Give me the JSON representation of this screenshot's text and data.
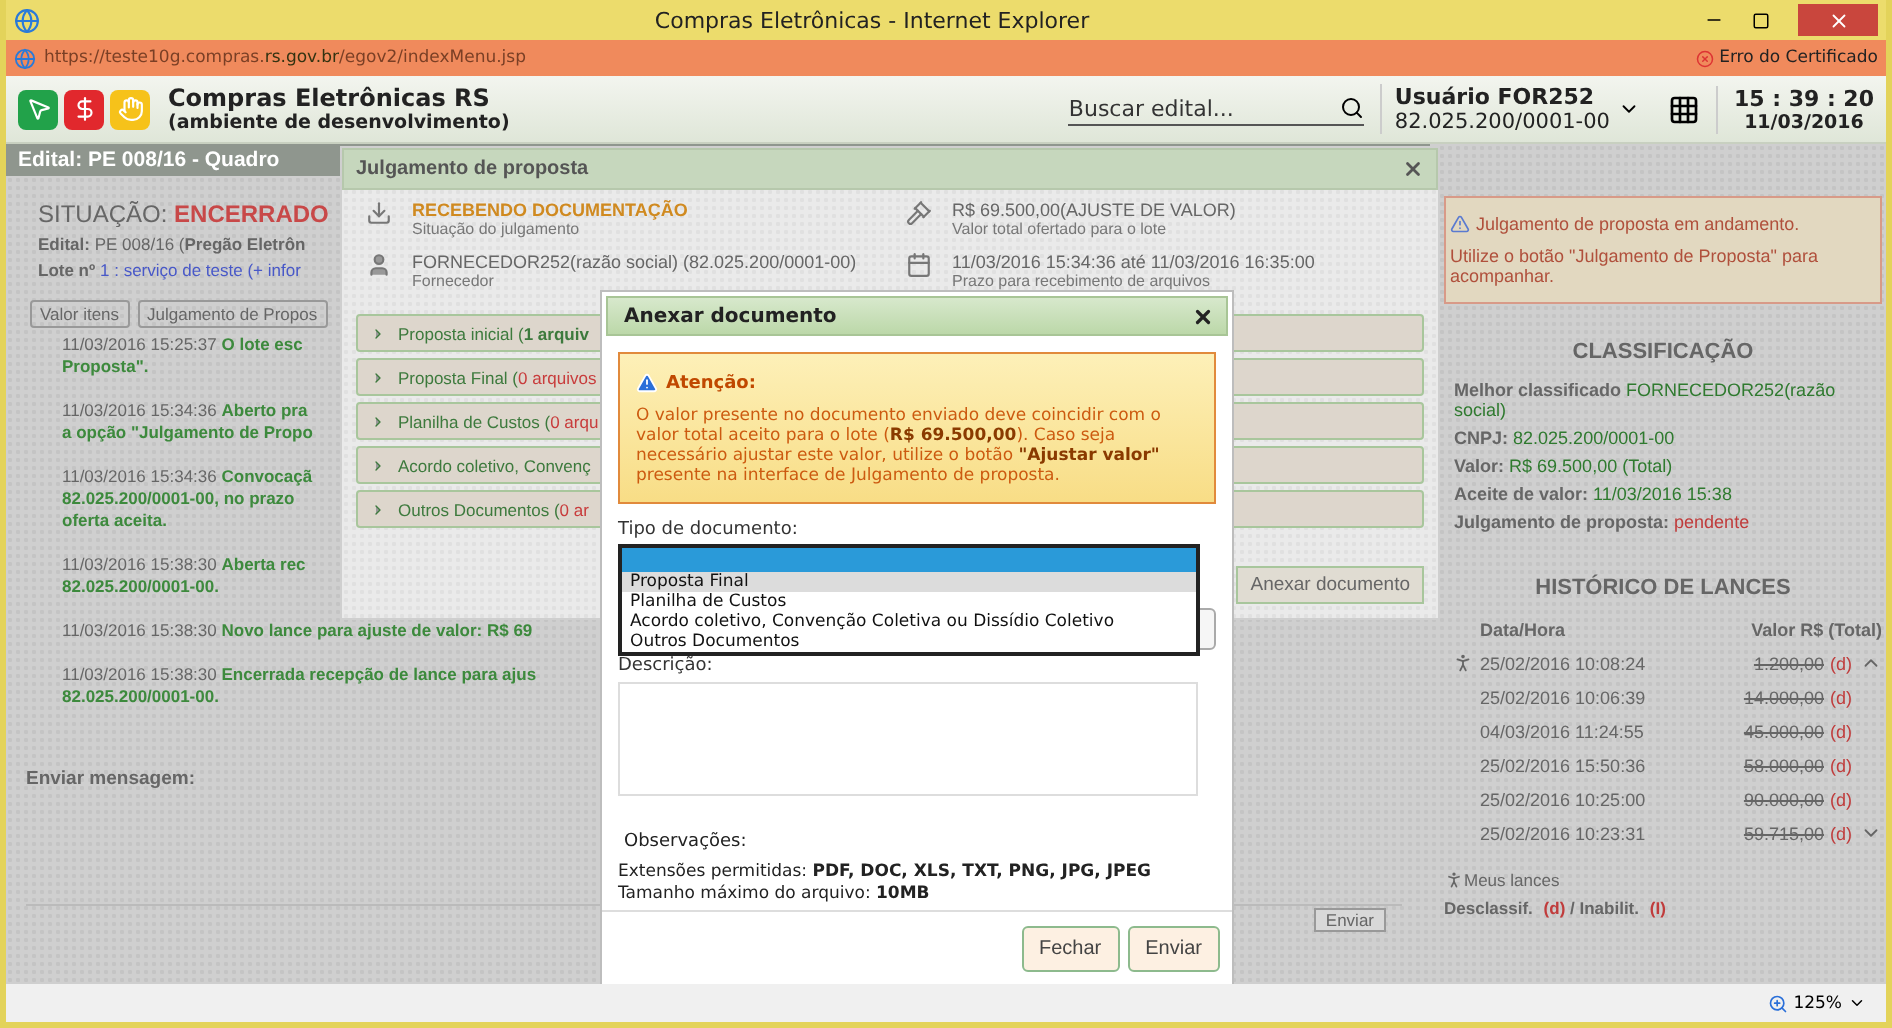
{
  "window": {
    "title": "Compras Eletrônicas - Internet Explorer"
  },
  "address_bar": {
    "url_start": "https://teste10g.compras.",
    "url_domain": "rs.gov.br",
    "url_end": "/egov2/indexMenu.jsp",
    "certificate_error": "Erro do Certificado"
  },
  "header": {
    "title": "Compras Eletrônicas RS",
    "subtitle": "(ambiente de desenvolvimento)",
    "search": {
      "placeholder": "Buscar edital..."
    },
    "user": "Usuário FOR252",
    "user_id": "82.025.200/0001-00",
    "time": "15 : 39 : 20",
    "date": "11/03/2016"
  },
  "page": {
    "heading": "Edital: PE 008/16 - Quadro",
    "situation_label": "SITUAÇÃO:",
    "situation": "ENCERRADO",
    "edital_line": "**Edital:** PE 008/16 (**Pregão Eletrôn**",
    "lote_label": "Lote nº",
    "lote_number": "1 :",
    "lote_name": "serviço de teste",
    "lote_more": "(+ infor",
    "buttons": [
      "Valor itens",
      "Julgamento de Propos"
    ],
    "log": [
      {
        "time": "11/03/2016 15:25:37",
        "lines": [
          "O lote esc",
          "Proposta\"."
        ]
      },
      {
        "time": "11/03/2016 15:34:36",
        "lines": [
          "Aberto pra",
          "a opção \"Julgamento de Propo"
        ]
      },
      {
        "time": "11/03/2016 15:34:36",
        "lines": [
          "Convocaçã",
          "82.025.200/0001-00, no prazo",
          "oferta aceita."
        ]
      },
      {
        "time": "11/03/2016 15:38:30",
        "lines": [
          "Aberta rec",
          "82.025.200/0001-00."
        ]
      },
      {
        "time": "11/03/2016 15:38:30",
        "lines": [
          "Novo lance para ajuste de valor: R$ 69"
        ]
      },
      {
        "time": "11/03/2016 15:38:30",
        "lines": [
          "Encerrada recepção de lance para ajus",
          "82.025.200/0001-00."
        ]
      }
    ],
    "message_label": "Enviar mensagem:",
    "send_button": "Enviar"
  },
  "side": {
    "alert_title": "Julgamento de proposta em andamento.",
    "alert_text": "Utilize o botão \"Julgamento de Proposta\" para acompanhar.",
    "classification_title": "CLASSIFICAÇÃO",
    "classification": [
      {
        "label": "Melhor classificado",
        "value": "FORNECEDOR252(razão social)",
        "kind": "ok"
      },
      {
        "label": "CNPJ:",
        "value": "82.025.200/0001-00",
        "kind": "ok"
      },
      {
        "label": "Valor:",
        "value": "R$ 69.500,00 (Total)",
        "kind": "ok"
      },
      {
        "label": "Aceite de valor:",
        "value": "11/03/2016 15:38",
        "kind": "ok"
      },
      {
        "label": "Julgamento de proposta:",
        "value": "pendente",
        "kind": "alert"
      }
    ],
    "history_title": "HISTÓRICO DE LANCES",
    "history_columns": [
      "Data/Hora",
      "Valor R$ (Total)"
    ],
    "history": [
      {
        "time": "25/02/2016 10:08:24",
        "value": "1.200,00",
        "flag": "(d)",
        "mine": true,
        "struck": true
      },
      {
        "time": "25/02/2016 10:06:39",
        "value": "14.000,00",
        "flag": "(d)",
        "mine": false,
        "struck": true
      },
      {
        "time": "04/03/2016 11:24:55",
        "value": "45.000,00",
        "flag": "(d)",
        "mine": false,
        "struck": true
      },
      {
        "time": "25/02/2016 15:50:36",
        "value": "58.000,00",
        "flag": "(d)",
        "mine": false,
        "struck": true
      },
      {
        "time": "25/02/2016 10:25:00",
        "value": "90.000,00",
        "flag": "(d)",
        "mine": false,
        "struck": true
      },
      {
        "time": "25/02/2016 10:23:31",
        "value": "59.715,00",
        "flag": "(d)",
        "mine": false,
        "struck": true
      }
    ],
    "legend": "Meus lances",
    "footer_label_1": "Desclassif.",
    "footer_flag_1": "(d)",
    "footer_label_2": "/ Inabilit.",
    "footer_flag_2": "(I)"
  },
  "judgement_dialog": {
    "title": "Julgamento de proposta",
    "info": [
      {
        "kind": "status",
        "value": "RECEBENDO DOCUMENTAÇÃO",
        "caption": "Situação do julgamento"
      },
      {
        "kind": "amount",
        "value": "R$ 69.500,00(AJUSTE DE VALOR)",
        "caption": "Valor total ofertado para o lote"
      },
      {
        "kind": "supplier",
        "value": "FORNECEDOR252(razão social) (82.025.200/0001-00)",
        "caption": "Fornecedor"
      },
      {
        "kind": "deadline",
        "value": "11/03/2016 15:34:36 até 11/03/2016 16:35:00",
        "caption": "Prazo para recebimento de arquivos"
      }
    ],
    "sections": [
      {
        "label": "Proposta inicial (",
        "count": "1 arquiv",
        "empty": false,
        "expanded": false
      },
      {
        "label": "Proposta Final (",
        "count": "0 arquivos",
        "empty": true,
        "expanded": false
      },
      {
        "label": "Planilha de Custos (",
        "count": "0 arqu",
        "empty": true,
        "expanded": false
      },
      {
        "label": "Acordo coletivo, Convenç",
        "expanded": false
      },
      {
        "label": "Outros Documentos (",
        "count": "0 ar",
        "empty": true,
        "expanded": false
      }
    ],
    "attach_button": "Anexar documento"
  },
  "attach_dialog": {
    "title": "Anexar documento",
    "warning_title": "Atenção:",
    "warning_text": "O valor presente no documento enviado deve coincidir com o valor total aceito para o lote (**R$ 69.500,00**). Caso seja necessário ajustar este valor, utilize o botão **\"Ajustar valor\"** presente na interface de Julgamento de proposta.",
    "type_label": "Tipo de documento:",
    "dropdown": {
      "expanded": true,
      "blank_selected": true,
      "options": [
        {
          "label": "Proposta Final",
          "hovered": true
        },
        {
          "label": "Planilha de Custos",
          "hovered": false
        },
        {
          "label": "Acordo coletivo, Convenção Coletiva ou Dissídio Coletivo",
          "hovered": false
        },
        {
          "label": "Outros Documentos",
          "hovered": false
        }
      ]
    },
    "description_label": "Descrição:",
    "notes_title": "Observações:",
    "notes": [
      "Extensões permitidas: **PDF, DOC, XLS, TXT, PNG, JPG, JPEG**",
      "Tamanho máximo do arquivo: **10MB**"
    ],
    "buttons": [
      "Fechar",
      "Enviar"
    ]
  },
  "status_bar": {
    "zoom": "125%"
  }
}
